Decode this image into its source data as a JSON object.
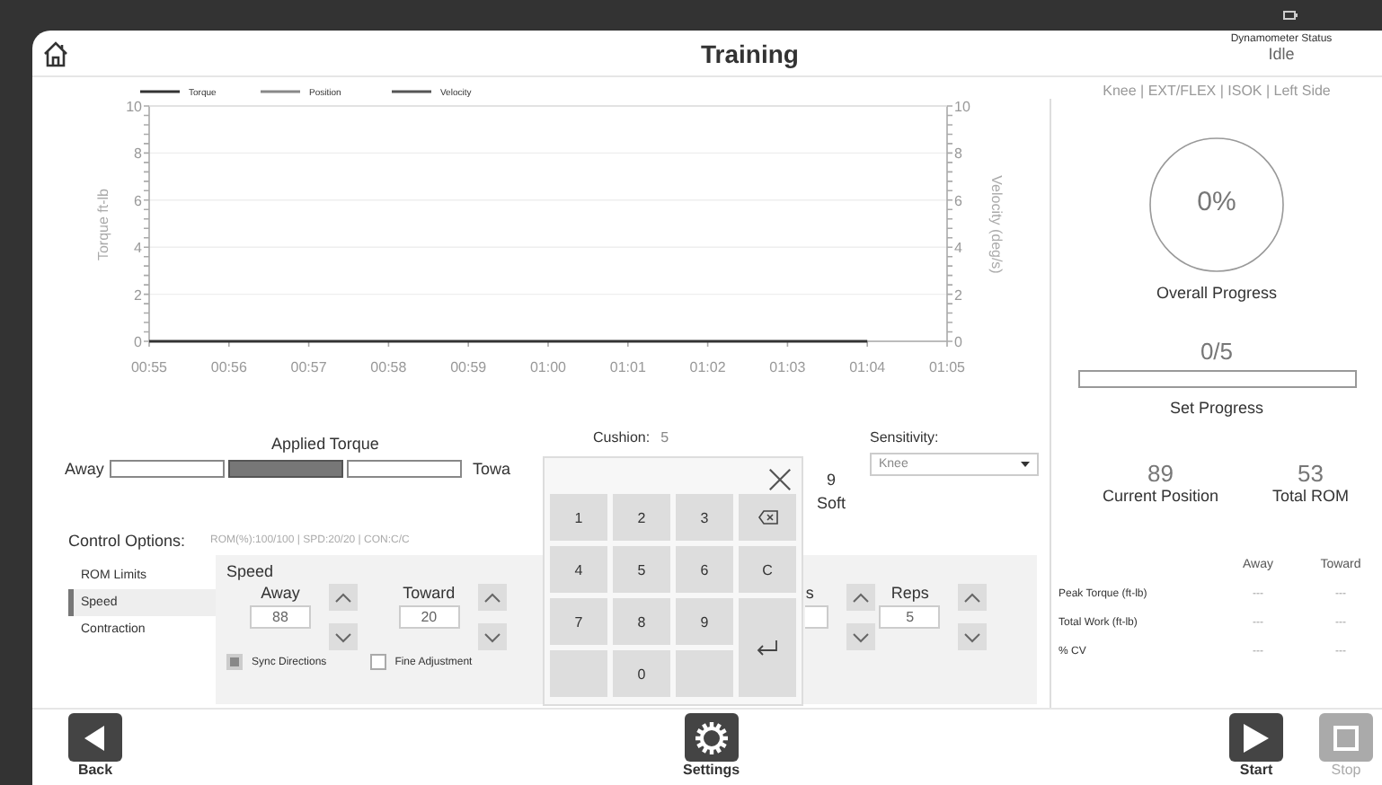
{
  "window": {
    "title": "Training"
  },
  "status": {
    "label": "Dynamometer Status",
    "value": "Idle"
  },
  "chart": {
    "chart_data": {
      "type": "line",
      "ylabel": "Torque ft-lb",
      "y2label": "Velocity (deg/s)",
      "categories": [
        "00:55",
        "00:56",
        "00:57",
        "00:58",
        "00:59",
        "01:00",
        "01:01",
        "01:02",
        "01:03",
        "01:04",
        "01:05"
      ],
      "series": [
        {
          "name": "Torque",
          "color": "#333333",
          "values": [
            0,
            0,
            0,
            0,
            0,
            0,
            0,
            0,
            0,
            0,
            null
          ]
        },
        {
          "name": "Position",
          "color": "#888888",
          "values": [
            null,
            null,
            null,
            null,
            null,
            null,
            null,
            null,
            null,
            null,
            null
          ]
        },
        {
          "name": "Velocity",
          "color": "#555555",
          "values": [
            null,
            null,
            null,
            null,
            null,
            null,
            null,
            null,
            null,
            null,
            null
          ]
        }
      ],
      "ylim": [
        0,
        10
      ],
      "yticks": [
        0,
        2,
        4,
        6,
        8,
        10
      ],
      "y2lim": [
        0,
        10
      ],
      "y2ticks": [
        0,
        2,
        4,
        6,
        8,
        10
      ],
      "grid": true
    }
  },
  "summary": "Knee | EXT/FLEX | ISOK | Left Side",
  "overall": {
    "value": "0%",
    "label": "Overall Progress"
  },
  "set_progress": {
    "value": "0/5",
    "label": "Set Progress",
    "level": 0
  },
  "stats": [
    {
      "value": "89",
      "label": "Current Position"
    },
    {
      "value": "53",
      "label": "Total ROM"
    }
  ],
  "results": {
    "columns": [
      "Away",
      "Toward"
    ],
    "rows": [
      {
        "label": "Peak Torque (ft-lb)",
        "values": [
          "---",
          "---"
        ]
      },
      {
        "label": "Total Work (ft-lb)",
        "values": [
          "---",
          "---"
        ]
      },
      {
        "label": "% CV",
        "values": [
          "---",
          "---"
        ]
      }
    ]
  },
  "applied_torque": {
    "title": "Applied Torque",
    "left": "Away",
    "right": "Towa",
    "segments": [
      {
        "filled": false
      },
      {
        "filled": true
      },
      {
        "filled": false
      }
    ]
  },
  "cushion": {
    "label": "Cushion:",
    "value": "5"
  },
  "scale_end": {
    "value": "9",
    "label": "Soft"
  },
  "sensitivity": {
    "label": "Sensitivity:",
    "value": "Knee"
  },
  "control_options": {
    "title": "Control Options:",
    "summary": "ROM(%):100/100 | SPD:20/20 | CON:C/C",
    "items": [
      {
        "label": "ROM Limits",
        "selected": false
      },
      {
        "label": "Speed",
        "selected": true
      },
      {
        "label": "Contraction",
        "selected": false
      }
    ]
  },
  "speed_panel": {
    "title": "Speed",
    "fields": [
      {
        "label": "Away",
        "value": "88"
      },
      {
        "label": "Toward",
        "value": "20"
      },
      {
        "label": "s"
      },
      {
        "label": "Reps",
        "value": "5"
      }
    ]
  },
  "checkboxes": [
    {
      "label": "Sync Directions",
      "checked": true
    },
    {
      "label": "Fine Adjustment",
      "checked": false
    }
  ],
  "keypad": {
    "keys": [
      {
        "kind": "digit",
        "label": "1"
      },
      {
        "kind": "digit",
        "label": "2"
      },
      {
        "kind": "digit",
        "label": "3"
      },
      {
        "kind": "backspace"
      },
      {
        "kind": "digit",
        "label": "4"
      },
      {
        "kind": "digit",
        "label": "5"
      },
      {
        "kind": "digit",
        "label": "6"
      },
      {
        "kind": "clear",
        "label": "C"
      },
      {
        "kind": "digit",
        "label": "7"
      },
      {
        "kind": "digit",
        "label": "8"
      },
      {
        "kind": "digit",
        "label": "9"
      },
      {
        "kind": "enter"
      },
      {
        "kind": "blank"
      },
      {
        "kind": "digit",
        "label": "0"
      },
      {
        "kind": "blank"
      }
    ]
  },
  "toolbar": [
    {
      "kind": "back",
      "label": "Back",
      "disabled": false
    },
    {
      "kind": "settings",
      "label": "Settings",
      "disabled": false
    },
    {
      "kind": "start",
      "label": "Start",
      "disabled": false
    },
    {
      "kind": "stop",
      "label": "Stop",
      "disabled": true
    }
  ]
}
